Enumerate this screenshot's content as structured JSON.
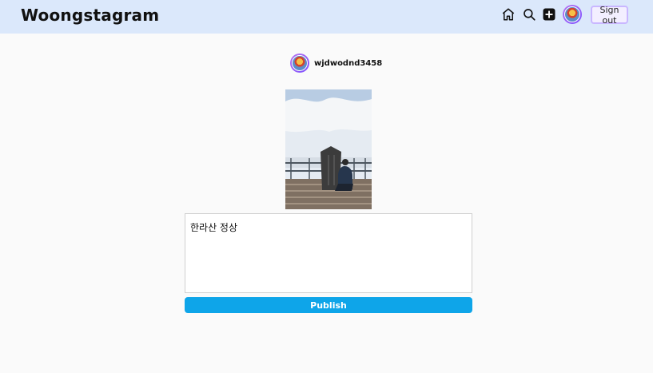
{
  "app": {
    "title": "Woongstagram"
  },
  "header": {
    "home_icon": "home-icon",
    "search_icon": "search-icon",
    "create_icon": "plus-square-icon",
    "sign_out_label": "Sign out"
  },
  "post": {
    "username": "wjdwodnd3458",
    "caption": "한라산 정상",
    "publish_label": "Publish"
  },
  "colors": {
    "header_bg": "#dbe8fb",
    "publish_button": "#0ea5e9",
    "avatar_ring": "#9b6af2"
  }
}
